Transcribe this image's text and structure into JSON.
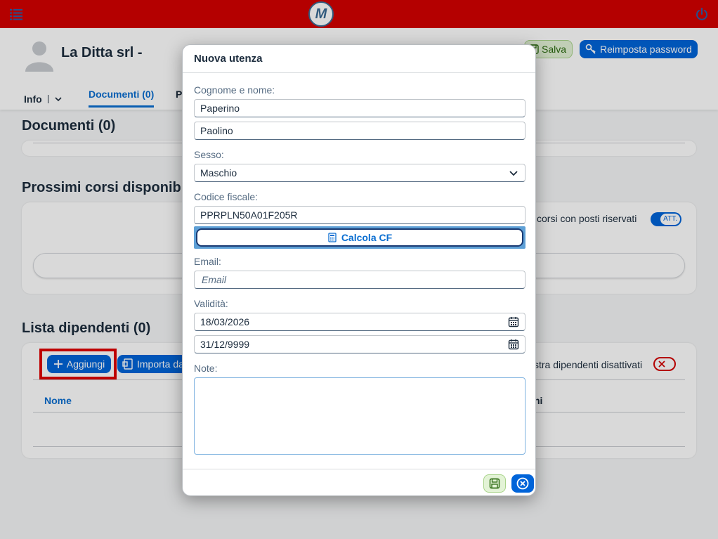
{
  "topbar": {
    "menu_icon": "list-menu-icon",
    "logo_letter": "M",
    "power_icon": "power-icon",
    "accent": "#d40000"
  },
  "header": {
    "company_name": "La Ditta srl -",
    "save_label": "Salva",
    "reset_password_label": "Reimposta password",
    "tabs": [
      {
        "label": "Info"
      },
      {
        "label": "Documenti (0)"
      },
      {
        "label": "P"
      }
    ]
  },
  "page": {
    "documenti_title": "Documenti (0)",
    "corsi_title": "Prossimi corsi disponibi",
    "corsi_toggle_label": "corsi con posti riservati",
    "corsi_toggle_state": "ATT.",
    "dipendenti_title": "Lista dipendenti (0)",
    "add_label": "Aggiungi",
    "import_label": "Importa da",
    "show_disabled_label": "stra dipendenti disattivati",
    "col_nome": "Nome",
    "col_right": "ni"
  },
  "dialog": {
    "title": "Nuova utenza",
    "name_label": "Cognome e nome:",
    "surname_value": "Paperino",
    "firstname_value": "Paolino",
    "sex_label": "Sesso:",
    "sex_value": "Maschio",
    "cf_label": "Codice fiscale:",
    "cf_value": "PPRPLN50A01F205R",
    "calc_cf_label": "Calcola CF",
    "email_label": "Email:",
    "email_placeholder": "Email",
    "validity_label": "Validità:",
    "valid_from": "18/03/2026",
    "valid_to": "31/12/9999",
    "notes_label": "Note:"
  }
}
